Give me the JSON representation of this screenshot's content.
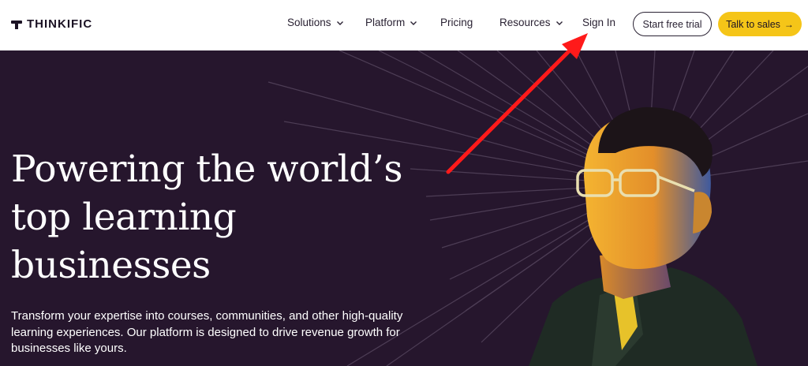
{
  "brand": {
    "name": "THINKIFIC"
  },
  "nav": {
    "items": [
      {
        "label": "Solutions",
        "has_dropdown": true
      },
      {
        "label": "Platform",
        "has_dropdown": true
      },
      {
        "label": "Pricing",
        "has_dropdown": false
      },
      {
        "label": "Resources",
        "has_dropdown": true
      },
      {
        "label": "Sign In",
        "has_dropdown": false
      }
    ],
    "start_trial_label": "Start free trial",
    "talk_sales_label": "Talk to sales",
    "talk_sales_icon": "arrow-right-icon"
  },
  "hero": {
    "headline_lines": [
      "Powering the world’s",
      "top learning",
      "businesses"
    ],
    "subcopy": "Transform your expertise into courses, communities, and other high-quality learning experiences. Our platform is designed to drive revenue growth for businesses like yours."
  },
  "colors": {
    "header_bg": "#ffffff",
    "hero_bg": "#26162d",
    "accent_yellow": "#f5c518",
    "annotation_red": "#ff1a1a"
  }
}
